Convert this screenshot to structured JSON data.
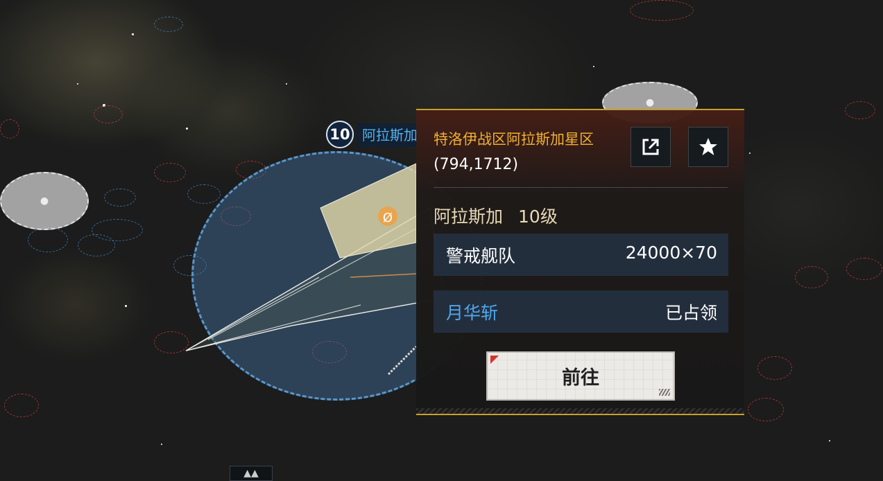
{
  "map": {
    "node_level": "10",
    "node_name": "阿拉斯加"
  },
  "info_panel": {
    "title": "特洛伊战区阿拉斯加星区",
    "coordinates": "(794,1712)",
    "node_name": "阿拉斯加",
    "node_level": "10级",
    "rows": [
      {
        "label": "警戒舰队",
        "value": "24000×70"
      },
      {
        "label": "月华斩",
        "value": "已占领"
      }
    ],
    "go_button_label": "前往",
    "icons": {
      "share": "external-link-icon",
      "favorite": "star-icon"
    }
  },
  "colors": {
    "title_gold": "#f0b030",
    "owner_blue": "#4fa8ee",
    "territory_blue": "#4878aa",
    "panel_border_gold": "#c8a02a"
  }
}
